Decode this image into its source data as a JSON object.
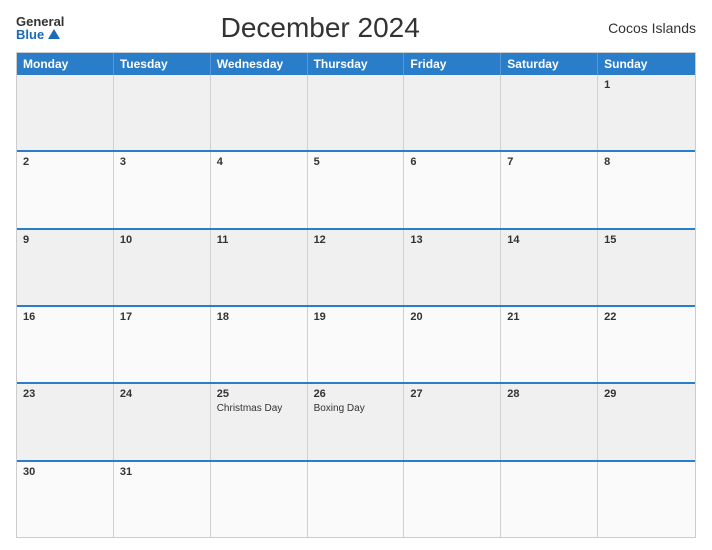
{
  "header": {
    "logo_general": "General",
    "logo_blue": "Blue",
    "title": "December 2024",
    "region": "Cocos Islands"
  },
  "calendar": {
    "day_headers": [
      "Monday",
      "Tuesday",
      "Wednesday",
      "Thursday",
      "Friday",
      "Saturday",
      "Sunday"
    ],
    "weeks": [
      [
        {
          "num": "",
          "events": []
        },
        {
          "num": "",
          "events": []
        },
        {
          "num": "",
          "events": []
        },
        {
          "num": "",
          "events": []
        },
        {
          "num": "",
          "events": []
        },
        {
          "num": "",
          "events": []
        },
        {
          "num": "1",
          "events": []
        }
      ],
      [
        {
          "num": "2",
          "events": []
        },
        {
          "num": "3",
          "events": []
        },
        {
          "num": "4",
          "events": []
        },
        {
          "num": "5",
          "events": []
        },
        {
          "num": "6",
          "events": []
        },
        {
          "num": "7",
          "events": []
        },
        {
          "num": "8",
          "events": []
        }
      ],
      [
        {
          "num": "9",
          "events": []
        },
        {
          "num": "10",
          "events": []
        },
        {
          "num": "11",
          "events": []
        },
        {
          "num": "12",
          "events": []
        },
        {
          "num": "13",
          "events": []
        },
        {
          "num": "14",
          "events": []
        },
        {
          "num": "15",
          "events": []
        }
      ],
      [
        {
          "num": "16",
          "events": []
        },
        {
          "num": "17",
          "events": []
        },
        {
          "num": "18",
          "events": []
        },
        {
          "num": "19",
          "events": []
        },
        {
          "num": "20",
          "events": []
        },
        {
          "num": "21",
          "events": []
        },
        {
          "num": "22",
          "events": []
        }
      ],
      [
        {
          "num": "23",
          "events": []
        },
        {
          "num": "24",
          "events": []
        },
        {
          "num": "25",
          "events": [
            "Christmas Day"
          ]
        },
        {
          "num": "26",
          "events": [
            "Boxing Day"
          ]
        },
        {
          "num": "27",
          "events": []
        },
        {
          "num": "28",
          "events": []
        },
        {
          "num": "29",
          "events": []
        }
      ],
      [
        {
          "num": "30",
          "events": []
        },
        {
          "num": "31",
          "events": []
        },
        {
          "num": "",
          "events": []
        },
        {
          "num": "",
          "events": []
        },
        {
          "num": "",
          "events": []
        },
        {
          "num": "",
          "events": []
        },
        {
          "num": "",
          "events": []
        }
      ]
    ]
  }
}
